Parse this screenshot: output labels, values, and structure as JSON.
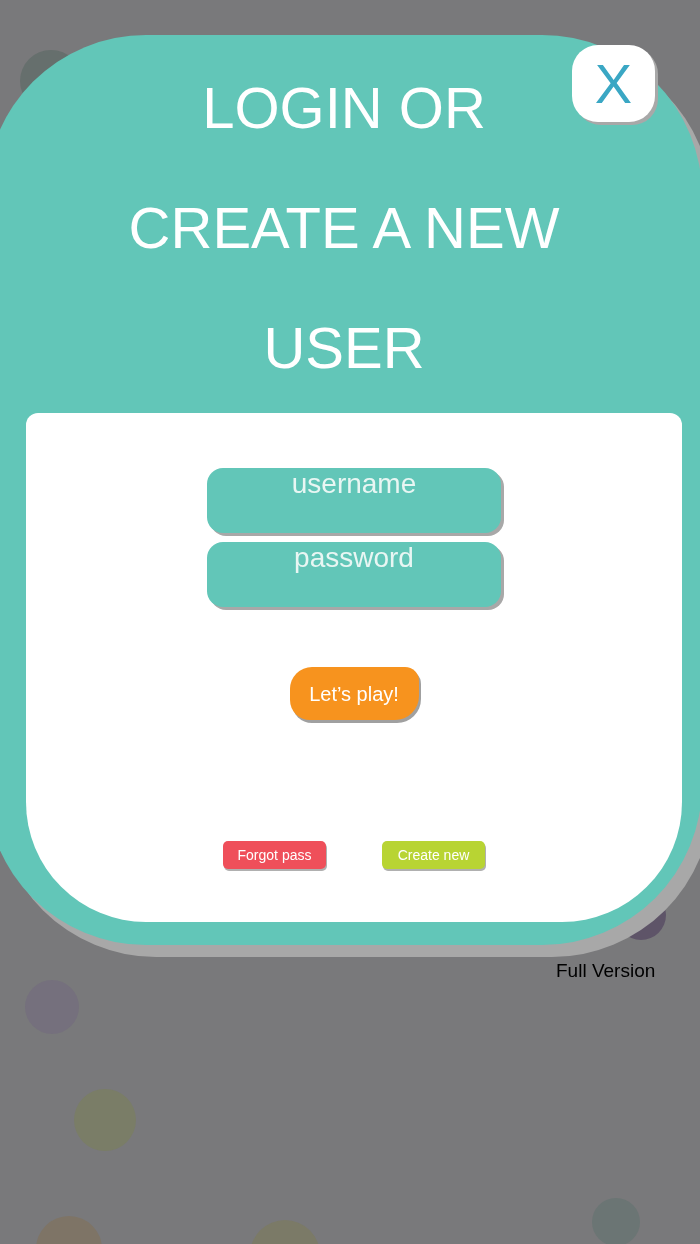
{
  "background": {
    "version_label": "Full Version"
  },
  "dialog": {
    "title": "LOGIN OR CREATE A NEW USER",
    "close_button": {
      "label": "X"
    },
    "fields": [
      {
        "placeholder": "username"
      },
      {
        "placeholder": "password"
      }
    ],
    "play_button": {
      "label": "Let’s play!"
    },
    "links": [
      {
        "label": "Forgot pass",
        "color": "#ef4f5a"
      },
      {
        "label": "Create new",
        "color": "#b8d433"
      }
    ]
  }
}
